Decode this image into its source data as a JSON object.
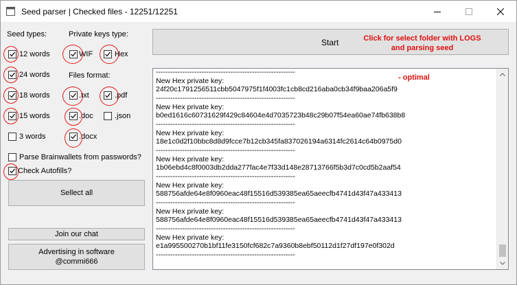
{
  "window": {
    "title": "Seed parser | Checked files - 12251/12251",
    "minimize_glyph": "—",
    "maximize_glyph": "☐",
    "close_glyph": "✕"
  },
  "seed_types": {
    "title": "Seed types:",
    "options": [
      {
        "label": "12 words",
        "checked": true,
        "highlighted": true
      },
      {
        "label": "24 words",
        "checked": true,
        "highlighted": true
      },
      {
        "label": "18 words",
        "checked": true,
        "highlighted": true
      },
      {
        "label": "15 words",
        "checked": true,
        "highlighted": true
      },
      {
        "label": "3 words",
        "checked": false,
        "highlighted": false
      }
    ]
  },
  "private_keys": {
    "title": "Private keys type:",
    "options": [
      {
        "label": "WIF",
        "checked": true,
        "highlighted": true
      },
      {
        "label": "Hex",
        "checked": true,
        "highlighted": true
      }
    ]
  },
  "files_format": {
    "title": "Files format:",
    "options": [
      {
        "label": ".txt",
        "checked": true,
        "highlighted": true
      },
      {
        "label": ".pdf",
        "checked": true,
        "highlighted": true
      },
      {
        "label": ".doc",
        "checked": true,
        "highlighted": true
      },
      {
        "label": ".json",
        "checked": false,
        "highlighted": false
      },
      {
        "label": ".docx",
        "checked": true,
        "highlighted": true
      }
    ]
  },
  "options": {
    "brainwallets": {
      "label": "Parse Brainwallets from passwords?",
      "checked": false
    },
    "autofills": {
      "label": "Check Autofills?",
      "checked": true
    }
  },
  "buttons": {
    "select_all": "Sellect all",
    "join_chat": "Join our chat",
    "advertising_line1": "Advertising in software",
    "advertising_line2": "@commi666",
    "start": "Start"
  },
  "annotations": {
    "hint_line1": "Click for select folder with LOGS",
    "hint_line2": "and parsing seed",
    "optimal": "-   optimal",
    "color": "#e01010"
  },
  "log": {
    "separator": "----------------------------------------------------------",
    "header": "New Hex private key:",
    "keys": [
      "24f20c1791256511cbb5047975f1f4003fc1cb8cd216aba0cb34f9baa206a5f9",
      "b0ed1616c60731629f429c84604e4d7035723b48c29b07f54ea60ae74fb638b8",
      "18e1c0d2f10bbc8d8d9fcce7b12cb345fa837026194a6314fc2614c64b0975d0",
      "1b06ebd4c8f0003db2dda277fac4e7f33d148e28713766f5b3d7c0cd5b2aaf54",
      "588756afde64e8f0960eac48f15516d539385ea65aeecfb4741d43f47a433413",
      "588756afde64e8f0960eac48f15516d539385ea65aeecfb4741d43f47a433413",
      "e1a995500270b1bf11fe3150fcf682c7a9360b8ebf50112d1f27df197e0f302d"
    ]
  }
}
